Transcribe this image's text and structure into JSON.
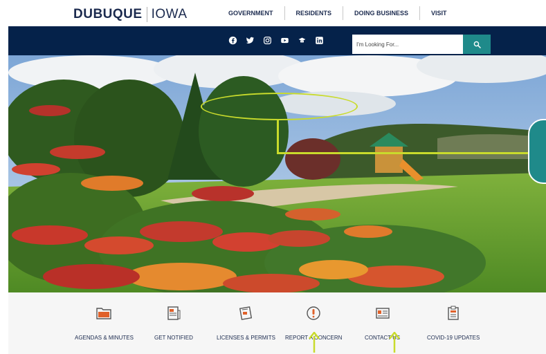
{
  "header": {
    "logo_bold": "DUBUQUE",
    "logo_light": "IOWA",
    "nav": [
      "GOVERNMENT",
      "RESIDENTS",
      "DOING BUSINESS",
      "VISIT"
    ]
  },
  "bluebar": {
    "socials": [
      "facebook-icon",
      "twitter-icon",
      "instagram-icon",
      "youtube-icon",
      "govdelivery-icon",
      "linkedin-icon"
    ],
    "search_placeholder": "I'm Looking For..."
  },
  "quick_links": [
    {
      "label": "AGENDAS & MINUTES",
      "icon": "folder-icon"
    },
    {
      "label": "GET NOTIFIED",
      "icon": "newspaper-icon"
    },
    {
      "label": "LICENSES & PERMITS",
      "icon": "permit-icon"
    },
    {
      "label": "REPORT A CONCERN",
      "icon": "alert-icon"
    },
    {
      "label": "CONTACT US",
      "icon": "contact-card-icon"
    },
    {
      "label": "COVID-19 UPDATES",
      "icon": "clipboard-icon"
    }
  ],
  "colors": {
    "navy": "#05224a",
    "teal": "#1f8a8a",
    "annotation": "#c9db2c",
    "icon_orange": "#e0612a"
  }
}
